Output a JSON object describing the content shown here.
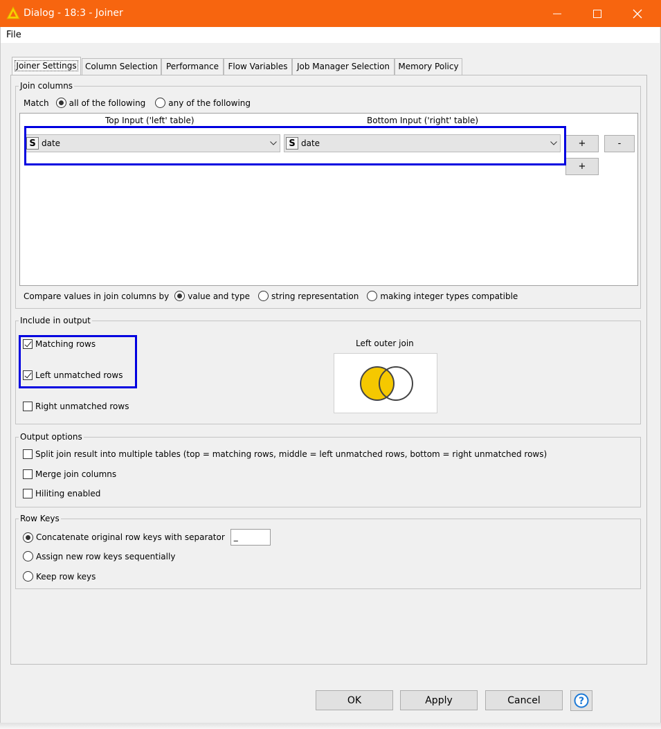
{
  "window": {
    "title": "Dialog - 18:3 - Joiner",
    "menu_file": "File",
    "brand_color": "#f7650f"
  },
  "tabs": [
    {
      "label": "Joiner Settings",
      "active": true
    },
    {
      "label": "Column Selection",
      "active": false
    },
    {
      "label": "Performance",
      "active": false
    },
    {
      "label": "Flow Variables",
      "active": false
    },
    {
      "label": "Job Manager Selection",
      "active": false
    },
    {
      "label": "Memory Policy",
      "active": false
    }
  ],
  "join_columns": {
    "legend": "Join columns",
    "match_label": "Match",
    "match_all_label": "all of the following",
    "match_any_label": "any of the following",
    "match_selected": "all",
    "top_input_header": "Top Input ('left' table)",
    "bottom_input_header": "Bottom Input ('right' table)",
    "left_column": {
      "type_icon": "S",
      "value": "date"
    },
    "right_column": {
      "type_icon": "S",
      "value": "date"
    },
    "add_label": "+",
    "remove_label": "-",
    "compare_label": "Compare values in join columns by",
    "compare_value_type": "value and type",
    "compare_string": "string representation",
    "compare_integer": "making integer types compatible",
    "compare_selected": "value and type"
  },
  "include_output": {
    "legend": "Include in output",
    "matching_rows": {
      "label": "Matching rows",
      "checked": true
    },
    "left_unmatched": {
      "label": "Left unmatched rows",
      "checked": true
    },
    "right_unmatched": {
      "label": "Right unmatched rows",
      "checked": false
    },
    "join_type_label": "Left outer join",
    "venn_fill_color": "#f5c800"
  },
  "output_options": {
    "legend": "Output options",
    "split": {
      "label": "Split join result into multiple tables (top = matching rows, middle = left unmatched rows, bottom = right unmatched rows)",
      "checked": false
    },
    "merge": {
      "label": "Merge join columns",
      "checked": false
    },
    "hiliting": {
      "label": "Hiliting enabled",
      "checked": false
    }
  },
  "row_keys": {
    "legend": "Row Keys",
    "concatenate": {
      "label": "Concatenate original row keys with separator",
      "selected": true
    },
    "separator_value": "_",
    "assign_new": {
      "label": "Assign new row keys sequentially",
      "selected": false
    },
    "keep": {
      "label": "Keep row keys",
      "selected": false
    }
  },
  "footer": {
    "ok": "OK",
    "apply": "Apply",
    "cancel": "Cancel",
    "help_icon": "question-icon"
  },
  "highlight_color": "#0000e0"
}
